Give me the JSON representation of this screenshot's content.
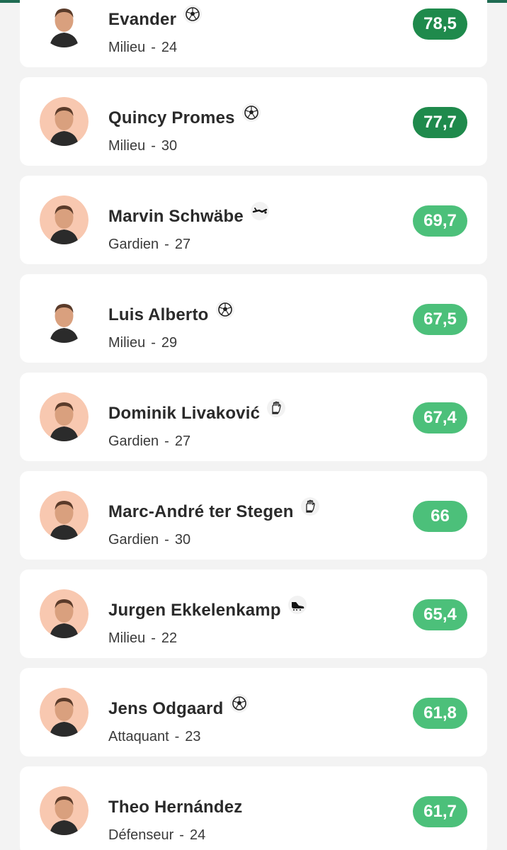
{
  "colors": {
    "header_green": "#1f6b52",
    "header_orange": "#f26a1b",
    "score_high": "#1f8a4c",
    "score_mid": "#4cc07a",
    "avatar_bg": "#f8c8b0"
  },
  "players": [
    {
      "name": "Evander",
      "position": "Milieu",
      "age": "24",
      "score": "78,5",
      "score_tier": "high",
      "icon": "soccer-ball-icon",
      "avatar_bg": false
    },
    {
      "name": "Quincy Promes",
      "position": "Milieu",
      "age": "30",
      "score": "77,7",
      "score_tier": "high",
      "icon": "soccer-ball-icon",
      "avatar_bg": true
    },
    {
      "name": "Marvin Schwäbe",
      "position": "Gardien",
      "age": "27",
      "score": "69,7",
      "score_tier": "mid",
      "icon": "diving-keeper-icon",
      "avatar_bg": true
    },
    {
      "name": "Luis Alberto",
      "position": "Milieu",
      "age": "29",
      "score": "67,5",
      "score_tier": "mid",
      "icon": "soccer-ball-icon",
      "avatar_bg": false
    },
    {
      "name": "Dominik Livaković",
      "position": "Gardien",
      "age": "27",
      "score": "67,4",
      "score_tier": "mid",
      "icon": "goalkeeper-glove-icon",
      "avatar_bg": true
    },
    {
      "name": "Marc-André ter Stegen",
      "position": "Gardien",
      "age": "30",
      "score": "66",
      "score_tier": "mid",
      "icon": "goalkeeper-glove-icon",
      "avatar_bg": true
    },
    {
      "name": "Jurgen Ekkelenkamp",
      "position": "Milieu",
      "age": "22",
      "score": "65,4",
      "score_tier": "mid",
      "icon": "football-boot-icon",
      "avatar_bg": true
    },
    {
      "name": "Jens Odgaard",
      "position": "Attaquant",
      "age": "23",
      "score": "61,8",
      "score_tier": "mid",
      "icon": "soccer-ball-icon",
      "avatar_bg": true
    },
    {
      "name": "Theo Hernández",
      "position": "Défenseur",
      "age": "24",
      "score": "61,7",
      "score_tier": "mid",
      "icon": "",
      "avatar_bg": true
    }
  ]
}
